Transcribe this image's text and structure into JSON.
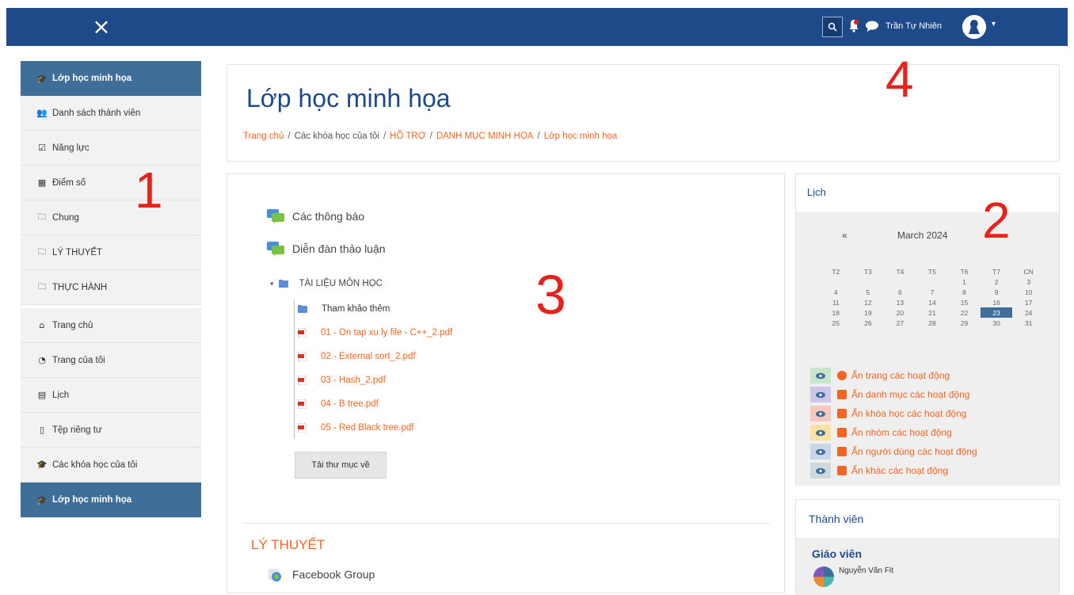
{
  "topbar": {
    "close_icon": "×",
    "user_name": "Trần Tự Nhiên",
    "caret": "▾",
    "brand_color": "#1f4a8a"
  },
  "sidebar": {
    "items": [
      {
        "icon": "graduation-cap-icon",
        "glyph": "🎓",
        "label": "Lớp học minh họa",
        "active": true
      },
      {
        "icon": "users-icon",
        "glyph": "👥",
        "label": "Danh sách thành viên"
      },
      {
        "icon": "check-square-icon",
        "glyph": "☑",
        "label": "Năng lực"
      },
      {
        "icon": "table-icon",
        "glyph": "▦",
        "label": "Điểm số"
      },
      {
        "icon": "folder-icon",
        "glyph": "🗀",
        "label": "Chung"
      },
      {
        "icon": "folder-icon",
        "glyph": "🗀",
        "label": "LÝ THUYẾT"
      },
      {
        "icon": "folder-icon",
        "glyph": "🗀",
        "label": "THỰC HÀNH"
      },
      {
        "icon": "home-icon",
        "glyph": "⌂",
        "label": "Trang chủ"
      },
      {
        "icon": "dashboard-icon",
        "glyph": "◔",
        "label": "Trang của tôi"
      },
      {
        "icon": "calendar-icon",
        "glyph": "▤",
        "label": "Lịch"
      },
      {
        "icon": "file-icon",
        "glyph": "▯",
        "label": "Tệp riêng tư"
      },
      {
        "icon": "graduation-cap-icon",
        "glyph": "🎓",
        "label": "Các khóa học của tôi"
      },
      {
        "icon": "graduation-cap-icon",
        "glyph": "🎓",
        "label": "Lớp học minh họa",
        "active": true
      }
    ]
  },
  "header": {
    "title": "Lớp học minh họa",
    "breadcrumb": [
      {
        "label": "Trang chủ",
        "link": true
      },
      {
        "label": "Các khóa học của tôi",
        "link": false
      },
      {
        "label": "HỖ TRỢ",
        "link": true
      },
      {
        "label": "DANH MỤC MINH HỌA",
        "link": true
      },
      {
        "label": "Lớp học minh họa",
        "link": true
      }
    ],
    "separator": "/"
  },
  "content": {
    "activities": [
      "Các thông báo",
      "Diễn đàn thảo luận"
    ],
    "folder": {
      "toggle": "▾",
      "name": "TÀI LIỆU MÔN HỌC",
      "subfolder": "Tham khảo thêm",
      "files": [
        "01 - On tap xu ly file - C++_2.pdf",
        "02 - External sort_2.pdf",
        "03 - Hash_2.pdf",
        "04 - B tree.pdf",
        "05 - Red Black tree.pdf"
      ],
      "download_label": "Tải thư mục về"
    },
    "section_title": "LÝ THUYẾT",
    "section_first_item": "Facebook Group"
  },
  "calendar": {
    "title": "Lịch",
    "prev": "«",
    "month": "March 2024",
    "weekdays": [
      "T2",
      "T3",
      "T4",
      "T5",
      "T6",
      "T7",
      "CN"
    ],
    "weeks": [
      [
        "",
        "",
        "",
        "",
        "1",
        "2",
        "3"
      ],
      [
        "4",
        "5",
        "6",
        "7",
        "8",
        "9",
        "10"
      ],
      [
        "11",
        "12",
        "13",
        "14",
        "15",
        "16",
        "17"
      ],
      [
        "18",
        "19",
        "20",
        "21",
        "22",
        "23",
        "24"
      ],
      [
        "25",
        "26",
        "27",
        "28",
        "29",
        "30",
        "31"
      ]
    ],
    "today": "23",
    "filters": [
      {
        "label": "Ẩn trang các hoạt động",
        "icon": "globe-icon",
        "swatch": "#c8e6c9",
        "iconColor": "#f26522"
      },
      {
        "label": "Ẩn danh mục các hoạt động",
        "icon": "cubes-icon",
        "swatch": "#d1c4e9",
        "iconColor": "#f26522"
      },
      {
        "label": "Ẩn khóa học các hoạt động",
        "icon": "graduation-cap-icon",
        "swatch": "#f8c8c0",
        "iconColor": "#f26522"
      },
      {
        "label": "Ẩn nhóm các hoạt động",
        "icon": "users-icon",
        "swatch": "#fde3a1",
        "iconColor": "#f26522"
      },
      {
        "label": "Ẩn người dùng các hoạt động",
        "icon": "user-icon",
        "swatch": "#c9d6e8",
        "iconColor": "#f26522"
      },
      {
        "label": "Ẩn khác các hoạt động",
        "icon": "calendar-icon",
        "swatch": "#cfd8dc",
        "iconColor": "#f26522"
      }
    ]
  },
  "members": {
    "title": "Thành viên",
    "role": "Giáo viên",
    "name": "Nguyễn Văn Fit"
  },
  "annotations": [
    "1",
    "2",
    "3",
    "4"
  ]
}
